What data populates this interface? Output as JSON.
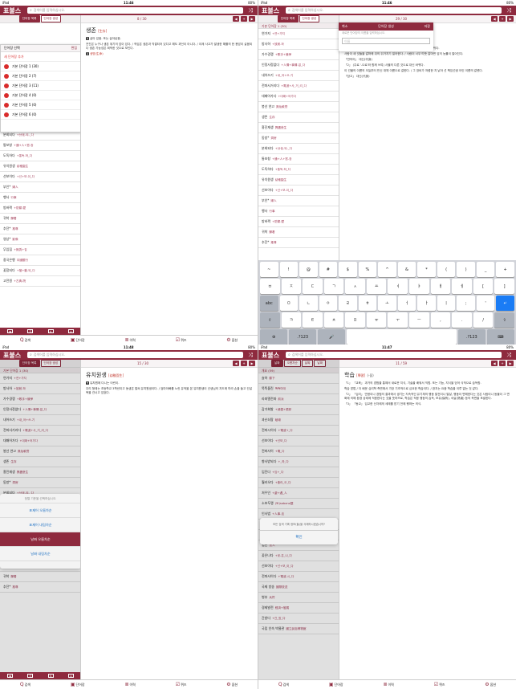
{
  "status": {
    "left": "iPad",
    "time_a": "11:46",
    "time_b": "11:48",
    "time_c": "11:47",
    "battery": "80%"
  },
  "app": {
    "logo": "표불스",
    "search_placeholder": "검색어를 입력하십시오.",
    "shuffle": "⤨",
    "accent": "#8e2a3e"
  },
  "tabs": [
    {
      "icon": "Q",
      "label": "검색"
    },
    {
      "icon": "▣",
      "label": "단어장"
    },
    {
      "icon": "≣",
      "label": "이력"
    },
    {
      "icon": "☑",
      "label": "퀴즈"
    },
    {
      "icon": "⚙",
      "label": "옵션"
    }
  ],
  "seg": {
    "a": "단어장 목록",
    "b": "단어장 생성"
  },
  "q1": {
    "counter": "8 / 30",
    "popup": {
      "title": "단어장 선택",
      "edit": "편집",
      "add": "새 단어장 추가",
      "books": [
        "기본 단어장 1 (30)",
        "기본 단어장 2 (7)",
        "기본 단어장 3 (11)",
        "기본 단어장 4 (0)",
        "기본 단어장 5 (0)",
        "기본 단어장 6 (0)"
      ]
    },
    "section": "생존 · 도무",
    "words": [
      {
        "w": "흥진재생",
        "g": "興盡悲生"
      },
      {
        "w": "동방*",
        "g": "洞房"
      },
      {
        "w": "분회되다",
        "g": "+分化-되-_다"
      },
      {
        "w": "통보창",
        "g": "+通+人+窓-창"
      },
      {
        "w": "도독하다",
        "g": "+통독-하_다"
      },
      {
        "w": "유치원생",
        "g": "幼稚園生"
      },
      {
        "w": "선보이다",
        "g": "+선+보-이_다"
      },
      {
        "w": "부인*",
        "g": "婦人"
      },
      {
        "w": "행사",
        "g": "行事"
      },
      {
        "w": "방바짝",
        "g": "+防禦-壁"
      },
      {
        "w": "귀착",
        "g": "歸着"
      },
      {
        "w": "추잔*",
        "g": "推尊"
      },
      {
        "w": "영상*",
        "g": "影像"
      },
      {
        "w": "무임집",
        "g": "+無賃+집"
      },
      {
        "w": "중국은행",
        "g": "中國銀行"
      },
      {
        "w": "꽃함되다",
        "g": "+發+動-되_다"
      },
      {
        "w": "고전원",
        "g": "+古典-院"
      }
    ],
    "headword": "생존",
    "hanja": "生存",
    "def1": "살아 있음. 또는 살아남음.",
    "ex1": "전진은 누구나 생존 위기의 앞이 있다. / 적임은 생존과 직결되어 있다고 해도 과언이 아니다. / 이제 사고가 발생한 해를의 한 용암이 살움되다 생존 가능성은 희박한 것으로 보인다.",
    "tags": "생명(生命)"
  },
  "q2": {
    "counter": "29 / 30",
    "modal": {
      "cancel": "취소",
      "title": "단어장 생성",
      "save": "저장",
      "hint": "새로운 단어장의 이름을 입력하십시오.",
      "field_label": "이름"
    },
    "list_header": "기본 단어장 1 (30)",
    "words": [
      {
        "w": "연가지",
        "g": "+연+가지"
      },
      {
        "w": "방사하",
        "g": "+放射-하"
      },
      {
        "w": "가수경쟁",
        "g": "+歌手+競爭"
      },
      {
        "w": "인정사정없다",
        "g": "+人情+事情-없_다"
      },
      {
        "w": "내어쓰기",
        "g": "+내_어+쓰-기"
      },
      {
        "w": "전파사거리다",
        "g": "+電波+사_거_리_다"
      },
      {
        "w": "대패어가다",
        "g": "+대패+어가다"
      },
      {
        "w": "봉선 연고",
        "g": "鳳仙軟膏"
      },
      {
        "w": "생존",
        "g": "生存"
      },
      {
        "w": "흥진재생",
        "g": "興盡悲生"
      },
      {
        "w": "동방*",
        "g": "洞房"
      },
      {
        "w": "분회되다",
        "g": "+分化-되-_다"
      },
      {
        "w": "통보창",
        "g": "+通+人+窓-창"
      },
      {
        "w": "도독하다",
        "g": "+통독-하_다"
      },
      {
        "w": "유치원생",
        "g": "幼稚園生"
      },
      {
        "w": "선보이다",
        "g": "+선+보-이_다"
      },
      {
        "w": "부인*",
        "g": "婦人"
      },
      {
        "w": "행사",
        "g": "行事"
      },
      {
        "w": "방바짝",
        "g": "+防禦-壁"
      },
      {
        "w": "귀착",
        "g": "歸着"
      },
      {
        "w": "추잔*",
        "g": "推尊"
      }
    ],
    "intro": "갈마드는",
    "def1": "「1」 (주로 '-으로'와 함께 쓰여) 자기 대신 다른 사람이나 사물을 대신 바뀌다.",
    "ex1": "사람이 새 것들을 갈마에 뒤의 뒤거지기 일어한다. / 사람이 너무 따뜻 갈마면 앞의 능률이 떨어진다.",
    "tag1": "「반의어」 대신(代身)",
    "def2": "「2」 (주로 '-으로'와 함께 쓰여) 사물의 다른 것으로 대신 바뀌다.",
    "ex2": "이 건물의 이름의 오늘부터 빈신 대체 이름으로 갈한다. / 그 장비가 저렴한 지 낡아 선 책임선생 아인 이름의 갈렸다.",
    "tag2": "「참고」 대신(代身)"
  },
  "keyboard": {
    "row0": [
      "~",
      "!",
      "@",
      "#",
      "$",
      "%",
      "^",
      "&",
      "*",
      "(",
      ")",
      "_",
      "+"
    ],
    "row0b": [
      "`",
      "1",
      "2",
      "3",
      "4",
      "5",
      "6",
      "7",
      "8",
      "9",
      "0",
      "-",
      "="
    ],
    "row1": [
      "ㅂ",
      "ㅈ",
      "ㄷ",
      "ㄱ",
      "ㅅ",
      "ㅛ",
      "ㅕ",
      "ㅑ",
      "ㅐ",
      "ㅔ",
      "[",
      "]"
    ],
    "row2": [
      "abc",
      "ㅁ",
      "ㄴ",
      "ㅇ",
      "ㄹ",
      "ㅎ",
      "ㅗ",
      "ㅓ",
      "ㅏ",
      "ㅣ",
      ";",
      "'",
      "↵"
    ],
    "row3": [
      "⇧",
      "ㅋ",
      "ㅌ",
      "ㅊ",
      "ㅍ",
      "ㅠ",
      "ㅜ",
      "ㅡ",
      ",",
      ".",
      "/",
      "⇧"
    ],
    "row4": [
      "⊕",
      ".?123",
      "🎤",
      "",
      ".?123",
      "⌨"
    ]
  },
  "q3": {
    "counter": "15 / 30",
    "list_header": "기본 단어장 1 (30)",
    "headword": "유치원생",
    "hanja": "幼稚園生",
    "def1": "유치원에 다니는 어린이.",
    "ex1": "우리 형제는 초등학교 3학년이고 동생은 벌써 유치원생이다. / 엄마아빠를 노린 유적을 본 유치원생이 선생님의 지도에 따라 손을 들고 건널목을 건너고 있었다.",
    "action": {
      "title": "정렬 기준을 선택하십시오.",
      "items": [
        "표제어 오름차순",
        "표제어 내림차순",
        "날짜 오름차순",
        "날짜 내림차순"
      ]
    }
  },
  "q4": {
    "counter": "11 / 59",
    "filters": [
      "날짜",
      "오름차순",
      "날짜",
      "날짜"
    ],
    "list_header": "개요 (59)",
    "headword": "학습",
    "hanja": "學習",
    "pos": "(-을)",
    "def1": "「1」 「교육」 과거의 경험을 통해서 새로운 지식, 기술을 배워서 익힘. 또는 기능, 지식을 얻어 식적으로 습득함.",
    "ex1": "학습 방법 / 더 배운 심리학 측면에서 가장 기초적으로 심요한 학습이다. / 완지는 요즘 학습을 이루 없는 것 같다.",
    "def2": "「2」 「심리」 반응이나 경험의 결과에서 생기는 지속적인 유기체의 행동 발전이나 발달, 행동이 변해한다는 것은 사람이나 동물이 그 변화에 의해 환경 상태에 적응한다는 것을 뜻하므로, 학습은 적응 행동의 습득, 보유(保有), 숙달(熟達) 등의 측면을 포괄한다.",
    "def3": "「3」 「동교」 입교한 신자에게 세례를 받기 전에 행하는 의식.",
    "alert": {
      "msg": "모든 검색 기록 정보(들)을 삭제하시겠습니까?",
      "ok": "확인"
    },
    "section": "학습 · 통왕",
    "words": [
      {
        "w": "슬하",
        "g": "膝下"
      },
      {
        "w": "똑똑돌린",
        "g": "똑똑마대"
      },
      {
        "w": "라파엘전파",
        "g": "前派"
      },
      {
        "w": "감가회발",
        "g": "+減價+償却"
      },
      {
        "w": "과난쇠팡",
        "g": "破壞"
      },
      {
        "w": "전파시이다",
        "g": "+電波+_다"
      },
      {
        "w": "선보이다",
        "g": "+선보_다"
      },
      {
        "w": "전파사이",
        "g": "+電_다"
      },
      {
        "w": "향사받되다",
        "g": "+_하_다"
      },
      {
        "w": "임진다",
        "g": "+임+_다"
      },
      {
        "w": "훨러오다",
        "g": "+흘러_오_다"
      },
      {
        "w": "처우인",
        "g": "+處+遇_人"
      },
      {
        "w": "소보두맹",
        "g": "(토)sobono整"
      },
      {
        "w": "인사법",
        "g": "+人事-法"
      },
      {
        "w": "오뚝거리다",
        "g": "+오뚝-거리_다"
      },
      {
        "w": "연기하다",
        "g": "+演技_다"
      },
      {
        "w": "법인",
        "g": "法人"
      },
      {
        "w": "꽂은나다",
        "g": "+꽂-은_나_다"
      },
      {
        "w": "선보이다",
        "g": "+선+보_이_다"
      },
      {
        "w": "전파사이다",
        "g": "+電波-시_다"
      },
      {
        "w": "국제 방송",
        "g": "國際放送"
      },
      {
        "w": "병부",
        "g": "兵符"
      },
      {
        "w": "경제발전",
        "g": "經濟+發展"
      },
      {
        "w": "간방다",
        "g": "+간_방_다"
      },
      {
        "w": "국립 인속 박물관",
        "g": "國立民俗博物館"
      }
    ]
  }
}
